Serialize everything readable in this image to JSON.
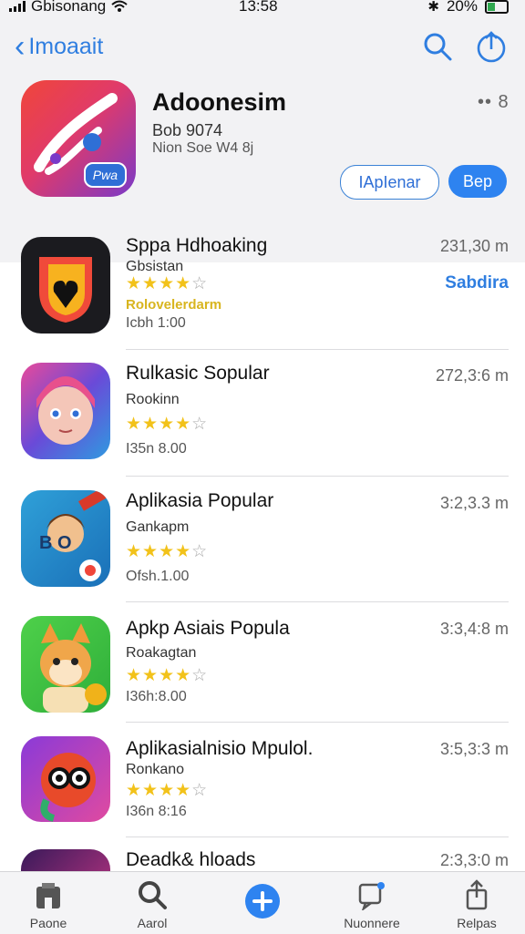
{
  "status": {
    "carrier": "Gbisonang",
    "time": "13:58",
    "battery": "20%"
  },
  "nav": {
    "back_label": "Imoaait"
  },
  "hero": {
    "title": "Adoonesim",
    "subtitle1": "Bob 9074",
    "subtitle2": "Nion Soe W4 8j",
    "more": "•• 8",
    "secondary_button": "IApIenar",
    "primary_button": "Bep",
    "badge": "Pwa"
  },
  "apps": [
    {
      "title": "Sppa Hdhoaking",
      "subtitle": "Gbsistan",
      "rating": 4,
      "promo": "Rolovelerdarm",
      "meta": "Icbh 1:00",
      "size": "231,30 m",
      "action": "Sabdira"
    },
    {
      "title": "Rulkasic Sopular",
      "subtitle": "Rookinn",
      "rating": 4,
      "meta": "I35n 8.00",
      "size": "272,3:6 m"
    },
    {
      "title": "Aplikasia Popular",
      "subtitle": "Gankapm",
      "rating": 4,
      "meta": "Ofsh.1.00",
      "size": "3:2,3.3 m"
    },
    {
      "title": "Apkp Asiais Popula",
      "subtitle": "Roakagtan",
      "rating": 3.5,
      "meta": "I36h:8.00",
      "size": "3:3,4:8 m"
    },
    {
      "title": "Aplikasialnisio Mpulol.",
      "subtitle": "Ronkano",
      "rating": 3.5,
      "meta": "I36n 8:16",
      "size": "3:5,3:3 m"
    },
    {
      "title": "Deadk& hloads",
      "size": "2:3,3:0 m"
    }
  ],
  "tabs": [
    {
      "label": "Paone",
      "icon": "store-icon"
    },
    {
      "label": "Aarol",
      "icon": "search-icon"
    },
    {
      "label": "",
      "icon": "add-icon"
    },
    {
      "label": "Nuonnere",
      "icon": "chat-icon"
    },
    {
      "label": "Relpas",
      "icon": "share-icon"
    }
  ],
  "colors": {
    "accent": "#2e83f0",
    "star": "#f2c21a",
    "header_bg": "#f2f2f4"
  }
}
